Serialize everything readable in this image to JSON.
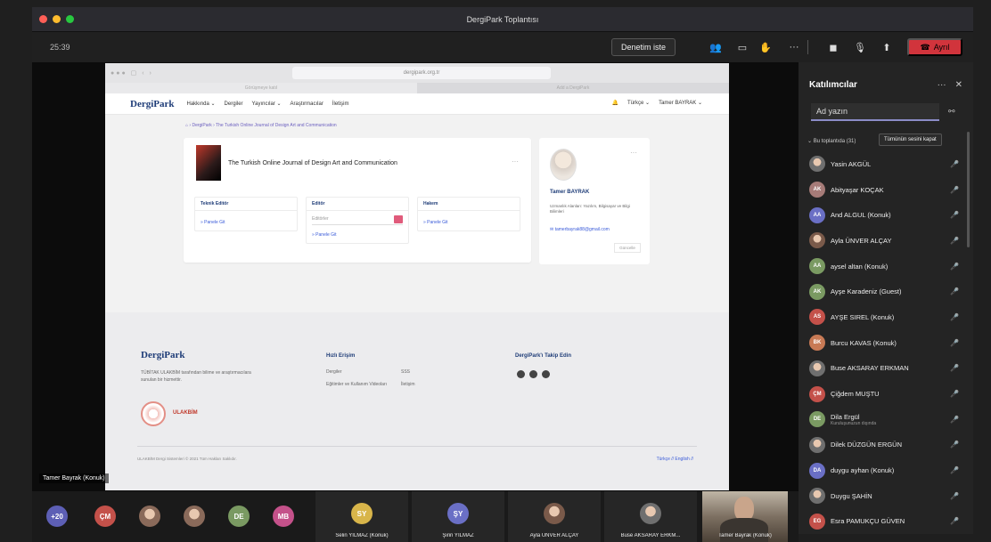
{
  "window": {
    "title": "DergiPark Toplantısı"
  },
  "toolbar": {
    "timer": "25:39",
    "request_control": "Denetim iste",
    "leave": "Ayrıl"
  },
  "browser": {
    "address": "dergipark.org.tr",
    "tabs": [
      "Görüşmeye katıl",
      "Add a DergiPark"
    ]
  },
  "site": {
    "logo": "DergiPark",
    "nav": [
      "Hakkında ⌄",
      "Dergiler",
      "Yayıncılar ⌄",
      "Araştırmacılar",
      "İletişim"
    ],
    "language": "Türkçe ⌄",
    "user_menu": "Tamer BAYRAK ⌄",
    "breadcrumb": "⌂ › DergiPark › The Turkish Online Journal of Design Art and Communication",
    "journal_title": "The Turkish Online Journal of Design Art and Communication",
    "roles": [
      {
        "title": "Teknik Editör",
        "link": "» Panele Git"
      },
      {
        "title": "Editör",
        "select": "Editörler",
        "link": "» Panele Git"
      },
      {
        "title": "Hakem",
        "link": "» Panele Git"
      }
    ],
    "profile": {
      "name": "Tamer BAYRAK",
      "area": "Uzmanlık Alanları: Yazılım, Bilgisayar ve Bilgi Bilimleri",
      "email": "tamerbayrak88@gmail.com",
      "button": "Güncelle"
    },
    "footer": {
      "logo": "DergiPark",
      "desc": "TÜBİTAK ULAKBİM tarafından bilime ve araştırmacılara sunulan bir hizmettir.",
      "ulakbim": "ULAKBİM",
      "quick_access": "Hızlı Erişim",
      "links_col1": [
        "Dergiler",
        "Eğitimler ve Kullanım Videoları"
      ],
      "links_col2": [
        "SSS",
        "İletişim"
      ],
      "follow": "DergiPark'ı Takip Edin",
      "copyright": "ULAKBİM Dergi Sistemleri © 2021 Tüm Hakları Saklıdır.",
      "languages": "Türkçe // English //"
    }
  },
  "presenter_label": "Tamer Bayrak (Konuk)",
  "participants": {
    "title": "Katılımcılar",
    "search_value": "Ad yazın",
    "section": "⌄ Bu toplantıda (31)",
    "mute_all": "Tümünün sesini kapat",
    "items": [
      {
        "initials": "",
        "name": "Yasin AKGÜL",
        "color": "#6f6f6f",
        "photo": true
      },
      {
        "initials": "AK",
        "name": "Abityaşar KOÇAK",
        "color": "#a67b78"
      },
      {
        "initials": "AA",
        "name": "And ALGUL (Konuk)",
        "color": "#6a6fc5"
      },
      {
        "initials": "",
        "name": "Ayla ÜNVER ALÇAY",
        "color": "#7a5a4a",
        "photo": true
      },
      {
        "initials": "AA",
        "name": "aysel altan (Konuk)",
        "color": "#7a9a62"
      },
      {
        "initials": "AK",
        "name": "Ayşe Karadeniz (Guest)",
        "color": "#7a9a62"
      },
      {
        "initials": "AS",
        "name": "AYŞE SIREL (Konuk)",
        "color": "#c4514a"
      },
      {
        "initials": "BK",
        "name": "Burcu KAVAS (Konuk)",
        "color": "#c87a55"
      },
      {
        "initials": "",
        "name": "Buse AKSARAY ERKMAN",
        "color": "#6f6f6f",
        "photo": true
      },
      {
        "initials": "ÇM",
        "name": "Çiğdem MUŞTU",
        "color": "#c4514a"
      },
      {
        "initials": "DE",
        "name": "Dila Ergül",
        "sub": "Kuruluşunuzun dışında",
        "color": "#7a9a62"
      },
      {
        "initials": "",
        "name": "Dilek DÜZGÜN ERGÜN",
        "color": "#6f6f6f",
        "photo": true
      },
      {
        "initials": "DA",
        "name": "duygu ayhan (Konuk)",
        "color": "#6a6fc5"
      },
      {
        "initials": "",
        "name": "Duygu ŞAHİN",
        "color": "#6f6f6f",
        "photo": true
      },
      {
        "initials": "EG",
        "name": "Esra PAMUKÇU GÜVEN",
        "color": "#c4514a"
      }
    ]
  },
  "strip": {
    "more_count": "+20",
    "avatars": [
      {
        "initials": "ÇM",
        "color": "#c4514a"
      },
      {
        "initials": "",
        "color": "#8a6a5a",
        "photo": true
      },
      {
        "initials": "",
        "color": "#8a6a5a",
        "photo": true
      },
      {
        "initials": "DE",
        "color": "#7a9a62"
      },
      {
        "initials": "MB",
        "color": "#c4518a"
      }
    ],
    "tiles": [
      {
        "initials": "SY",
        "name": "Selin YILMAZ (Konuk)",
        "color": "#d8b54a"
      },
      {
        "initials": "ŞY",
        "name": "Şirin YILMAZ",
        "color": "#6a6fc5"
      },
      {
        "initials": "",
        "name": "Ayla ÜNVER ALÇAY",
        "color": "#7a5a4a",
        "photo": true
      },
      {
        "initials": "",
        "name": "Buse AKSARAY ERKM...",
        "color": "#6f6f6f",
        "photo": true
      }
    ],
    "video_label": "Tamer Bayrak (Konuk)"
  },
  "colors": {
    "leave": "#d1343c",
    "accent": "#8b8cc7",
    "brand": "#1f3d78"
  }
}
